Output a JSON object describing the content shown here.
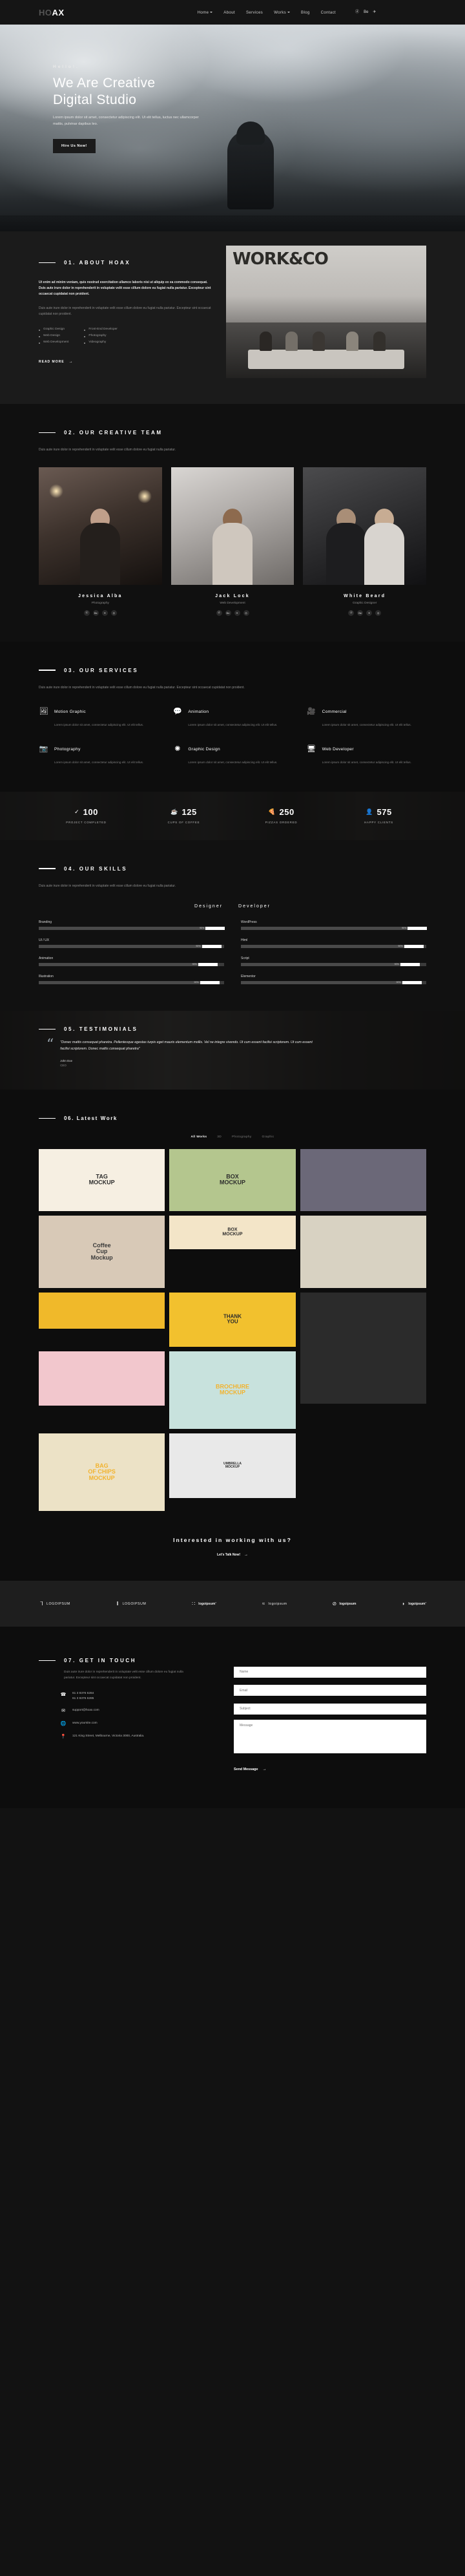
{
  "nav": {
    "logo_dim": "HO",
    "logo_bold": "AX",
    "links": [
      {
        "label": "Home",
        "has_caret": true
      },
      {
        "label": "About",
        "has_caret": false
      },
      {
        "label": "Services",
        "has_caret": false
      },
      {
        "label": "Works",
        "has_caret": true
      },
      {
        "label": "Blog",
        "has_caret": false
      },
      {
        "label": "Contact",
        "has_caret": false
      }
    ],
    "socials": [
      "dribbble-icon",
      "behance-icon",
      "twitter-icon"
    ],
    "social_glyphs": [
      "ⓓ",
      "Be",
      "✈"
    ]
  },
  "hero": {
    "hello": "Hello!.",
    "title_line1": "We Are Creative",
    "title_line2": "Digital Studio",
    "subtitle": "Lorem ipsum dolor sit amet, consectetur adipiscing elit. Ut elit tellus, luctus nec ullamcorper mattis, pulvinar dapibus leo.",
    "button": "Hire Us Now!"
  },
  "about": {
    "number_title": "01. ABOUT HOAX",
    "paragraph1": "Ut enim ad minim veniam, quis nostrud exercitation ullamco laboris nisi ut aliquip ex ea commodo consequat. Duis aute irure dolor in reprehenderit in voluptate velit esse cillum dolore eu fugiat nulla pariatur. Excepteur sint occaecat cupidatat non proident.",
    "paragraph2": "Duis aute irure dolor in reprehenderit in voluptate velit esse cillum dolore eu fugiat nulla pariatur. Excepteur sint occaecat cupidatat non proident.",
    "list_left": [
      "Graphic Design",
      "Web Design",
      "Web Development"
    ],
    "list_right": [
      "Front-End Developer",
      "Photography",
      "Videography"
    ],
    "read_more": "READ MORE",
    "image_word": "WORK&CO"
  },
  "team": {
    "number_title": "02. OUR CREATIVE TEAM",
    "description": "Duis aute irure dolor in reprehenderit in voluptate velit esse cillum dolore eu fugiat nulla pariatur.",
    "members": [
      {
        "name": "Jessica Alba",
        "role": "Photography"
      },
      {
        "name": "Jack Lock",
        "role": "Web Development"
      },
      {
        "name": "White Beard",
        "role": "Graphic Designer"
      }
    ],
    "social_glyphs": [
      "ⓓ",
      "Be",
      "✈",
      "◎"
    ]
  },
  "services": {
    "number_title": "03. OUR SERVICES",
    "description": "Duis aute irure dolor in reprehenderit in voluptate velit esse cillum dolore eu fugiat nulla pariatur. Excepteur sint occaecat cupidatat non proident.",
    "items": [
      {
        "name": "Motion Graphic",
        "icon": "image-stack-icon",
        "glyph": "Ὓc",
        "desc": "Lorem ipsum dolor sit amet, consectetur adipiscing elit. Ut elit tellus."
      },
      {
        "name": "Animation",
        "icon": "chat-bubble-icon",
        "glyph": "●",
        "desc": "Lorem ipsum dolor sit amet, consectetur adipiscing elit. Ut elit tellus."
      },
      {
        "name": "Commercial",
        "icon": "video-camera-icon",
        "glyph": "▶",
        "desc": "Lorem ipsum dolor sit amet, consectetur adipiscing elit. Ut elit tellus."
      },
      {
        "name": "Photography",
        "icon": "photo-icon",
        "glyph": "▣",
        "desc": "Lorem ipsum dolor sit amet, consectetur adipiscing elit. Ut elit tellus."
      },
      {
        "name": "Graphic Design",
        "icon": "magic-wand-icon",
        "glyph": "✦",
        "desc": "Lorem ipsum dolor sit amet, consectetur adipiscing elit. Ut elit tellus."
      },
      {
        "name": "Web Developer",
        "icon": "monitor-icon",
        "glyph": "▭",
        "desc": "Lorem ipsum dolor sit amet, consectetur adipiscing elit. Ut elit tellus."
      }
    ]
  },
  "counters": [
    {
      "value": "100",
      "label": "PROJECT COMPLETED",
      "icon": "checklist-icon",
      "glyph": "✔"
    },
    {
      "value": "125",
      "label": "CUPS OF COFFEE",
      "icon": "coffee-cup-icon",
      "glyph": "☕"
    },
    {
      "value": "250",
      "label": "PIZZAS ORDERED",
      "icon": "pizza-slice-icon",
      "glyph": "◢"
    },
    {
      "value": "575",
      "label": "HAPPY CLIENTS",
      "icon": "person-icon",
      "glyph": "☺"
    }
  ],
  "skills": {
    "number_title": "04. OUR SKILLS",
    "description": "Duis aute irure dolor in reprehenderit in voluptate velit esse cillum dolore eu fugiat nulla pariatur.",
    "tabs": [
      "Designer",
      "Developer"
    ],
    "designer": [
      {
        "name": "Branding",
        "pct": "90%",
        "value": 90
      },
      {
        "name": "UI / UX",
        "pct": "90%",
        "value": 90
      },
      {
        "name": "Animation",
        "pct": "90%",
        "value": 90
      },
      {
        "name": "Illustration",
        "pct": "90%",
        "value": 90
      }
    ],
    "developer": [
      {
        "name": "WordPress",
        "pct": "90%",
        "value": 90
      },
      {
        "name": "Html",
        "pct": "90%",
        "value": 90
      },
      {
        "name": "Script",
        "pct": "90%",
        "value": 90
      },
      {
        "name": "Elementor",
        "pct": "90%",
        "value": 90
      }
    ]
  },
  "testimonials": {
    "number_title": "05. TESTIMONIALS",
    "quote": "\"Donec mattis consequat pharetra. Pellentesque egestas turpis eget mauris elementum mollis. Vel ne integre vivendo. Ut cum essent facilisi scriptorem. Ut cum essent facilisi scriptorem. Donec mattis consequat pharetra\"",
    "author": "John Doe",
    "role": "CEO"
  },
  "works": {
    "number_title": "06. Latest Work",
    "filters": [
      "All Works",
      "3D",
      "Photography",
      "Graphic"
    ],
    "active_filter": "All Works",
    "items": [
      {
        "label": "TAG\nMOCKUP",
        "bg": "#efd9b4",
        "fg": "#2c2c2c",
        "h": 96,
        "card": "#f6efe2"
      },
      {
        "label": "BOX\nMOCKUP",
        "bg": "#b4c68e",
        "fg": "#2c2c2c",
        "h": 96,
        "card": "#e6e2cf"
      },
      {
        "label": "",
        "bg": "#6b6878",
        "fg": "#fff",
        "h": 96,
        "card": "#8f8d9a"
      },
      {
        "label": "Coffee\nCup\nMockup",
        "bg": "#d8c9b7",
        "fg": "#3a3a3a",
        "h": 112,
        "card": "#e9dcc9"
      },
      {
        "label": "BOX\nMOCKUP",
        "bg": "#f3e5c8",
        "fg": "#2c2c2c",
        "h": 52,
        "card": "#f7edd6"
      },
      {
        "label": "",
        "bg": "#d8d2c2",
        "fg": "#2c2c2c",
        "h": 112,
        "card": "#efe9db"
      },
      {
        "label": "",
        "bg": "#f0b92a",
        "fg": "#fff",
        "h": 56,
        "card": "#f5cf63"
      },
      {
        "label": "THANK\nYOU",
        "bg": "#f2c12e",
        "fg": "#2c2c2c",
        "h": 84,
        "card": "#f6d96e"
      },
      {
        "label": "",
        "bg": "#2b2b2b",
        "fg": "#fff",
        "h": 172,
        "card": "#3a3a3a"
      },
      {
        "label": "",
        "bg": "#f2c7cd",
        "fg": "#2c2c2c",
        "h": 84,
        "card": "#f7d9de"
      },
      {
        "label": "BROCHURE\nMOCKUP",
        "bg": "#c8e2dd",
        "fg": "#f2b32e",
        "h": 120,
        "card": "#d6ebe6"
      },
      {
        "label": "BAG\nOF CHIPS\nMOCKUP",
        "bg": "#ece2c6",
        "fg": "#f2b32e",
        "h": 120,
        "card": "#f1ead3"
      },
      {
        "label": "UMBRELLA\nMOCKUP",
        "bg": "#e9e9e9",
        "fg": "#2c2c2c",
        "h": 100,
        "card": "#f0f0f0"
      }
    ],
    "cta_title": "Interested in working with us?",
    "cta_link": "Let's Talk Now!"
  },
  "clients": [
    {
      "name": "LOGOIPSUM",
      "icon": "wheat-icon",
      "glyph": "⑂",
      "bold": false
    },
    {
      "name": "LOGOIPSUM",
      "icon": "bars-icon",
      "glyph": "‖",
      "bold": false
    },
    {
      "name": "logoipsum’",
      "icon": "dots-icon",
      "glyph": "∷",
      "bold": true
    },
    {
      "name": "logoipsum",
      "icon": "waves-icon",
      "glyph": "≈",
      "bold": false
    },
    {
      "name": "logoipsum",
      "icon": "circle-slash-icon",
      "glyph": "⊘",
      "bold": true
    },
    {
      "name": "logoipsum’",
      "icon": "half-circle-icon",
      "glyph": "◗",
      "bold": true
    }
  ],
  "contact": {
    "number_title": "07. GET IN TOUCH",
    "description": "Duis aute irure dolor in reprehenderit in voluptate velit esse cillum dolore eu fugiat nulla pariatur. Excepteur sint occaecat cupidatat non proident.",
    "phone_line1": "61 3 8376 6284",
    "phone_line2": "61 3 8376 6285",
    "email": "support@hoax.com",
    "website": "www.yoursite.com",
    "address": "121 King Street, Melbourne, Victoria 3000, Australia.",
    "form": {
      "name_placeholder": "Name",
      "email_placeholder": "Email",
      "subject_placeholder": "Subject",
      "message_placeholder": "Message",
      "submit": "Send Message"
    }
  }
}
